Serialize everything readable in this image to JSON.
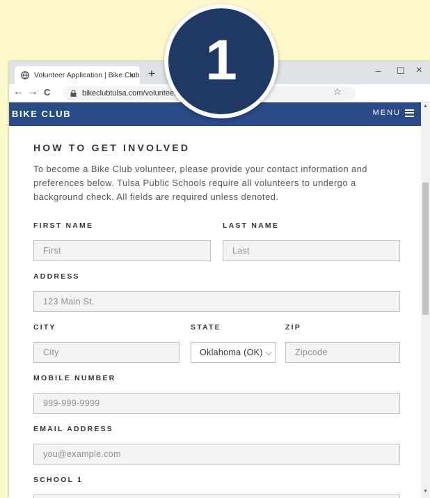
{
  "browser": {
    "tab_title": "Volunteer Application | Bike Club",
    "tab_close": "×",
    "new_tab": "+",
    "window_controls": {
      "minimize": "–",
      "maximize": "☐",
      "close": "×"
    },
    "nav": {
      "back": "←",
      "forward": "→",
      "reload": "C"
    },
    "url": "bikeclubtulsa.com/volunteer.p",
    "bookmark": "☆"
  },
  "site": {
    "brand": "BIKE CLUB",
    "menu_label": "MENU"
  },
  "form": {
    "heading": "HOW TO GET INVOLVED",
    "intro": "To become a Bike Club volunteer, please provide your contact information and preferences below. Tulsa Public Schools require all volunteers to undergo a background check. All fields are required unless denoted.",
    "first_name": {
      "label": "FIRST NAME",
      "placeholder": "First"
    },
    "last_name": {
      "label": "LAST NAME",
      "placeholder": "Last"
    },
    "address": {
      "label": "ADDRESS",
      "placeholder": "123 Main St."
    },
    "city": {
      "label": "CITY",
      "placeholder": "City"
    },
    "state": {
      "label": "STATE",
      "value": "Oklahoma (OK)"
    },
    "zip": {
      "label": "ZIP",
      "placeholder": "Zipcode"
    },
    "mobile": {
      "label": "MOBILE NUMBER",
      "placeholder": "999-999-9999"
    },
    "email": {
      "label": "EMAIL ADDRESS",
      "placeholder": "you@example.com"
    },
    "school1": {
      "label": "SCHOOL 1"
    }
  },
  "badge": {
    "number": "1"
  },
  "colors": {
    "page_bg": "#fdf8cc",
    "site_bar": "#2a4a88",
    "badge": "#1f3864"
  }
}
